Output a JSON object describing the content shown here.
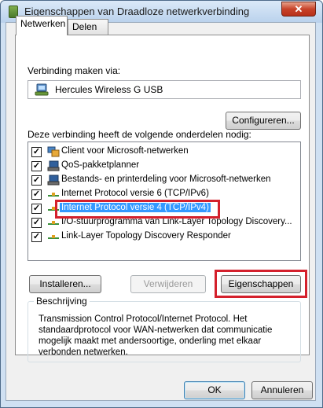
{
  "window": {
    "title": "Eigenschappen van Draadloze netwerkverbinding",
    "close_glyph": "✕"
  },
  "tabs": [
    {
      "label": "Netwerken",
      "active": true
    },
    {
      "label": "Delen",
      "active": false
    }
  ],
  "connection": {
    "label": "Verbinding maken via:",
    "adapter_name": "Hercules Wireless G USB",
    "adapter_icon": "network-adapter-icon",
    "configure_button": "Configureren..."
  },
  "components": {
    "label": "Deze verbinding heeft de volgende onderdelen nodig:",
    "items": [
      {
        "label": "Client voor Microsoft-netwerken",
        "checked": true,
        "icon": "client-icon"
      },
      {
        "label": "QoS-pakketplanner",
        "checked": true,
        "icon": "service-icon"
      },
      {
        "label": "Bestands- en printerdeling voor Microsoft-netwerken",
        "checked": true,
        "icon": "service-icon"
      },
      {
        "label": "Internet Protocol versie 6 (TCP/IPv6)",
        "checked": true,
        "icon": "protocol-icon"
      },
      {
        "label": "Internet Protocol versie 4 (TCP/IPv4)",
        "checked": true,
        "icon": "protocol-icon",
        "selected": true
      },
      {
        "label": "I/O-stuurprogramma van Link-Layer Topology Discovery...",
        "checked": true,
        "icon": "protocol-icon"
      },
      {
        "label": "Link-Layer Topology Discovery Responder",
        "checked": true,
        "icon": "protocol-icon"
      }
    ],
    "check_glyph": "✓"
  },
  "actions": {
    "install": "Installeren...",
    "remove": "Verwijderen",
    "properties": "Eigenschappen"
  },
  "description": {
    "legend": "Beschrijving",
    "text": "Transmission Control Protocol/Internet Protocol. Het standaardprotocol voor WAN-netwerken dat communicatie mogelijk maakt met andersoortige, onderling met elkaar verbonden netwerken."
  },
  "footer": {
    "ok": "OK",
    "cancel": "Annuleren"
  },
  "colors": {
    "annotation_red": "#d4202c",
    "selection_blue": "#3399ff"
  }
}
